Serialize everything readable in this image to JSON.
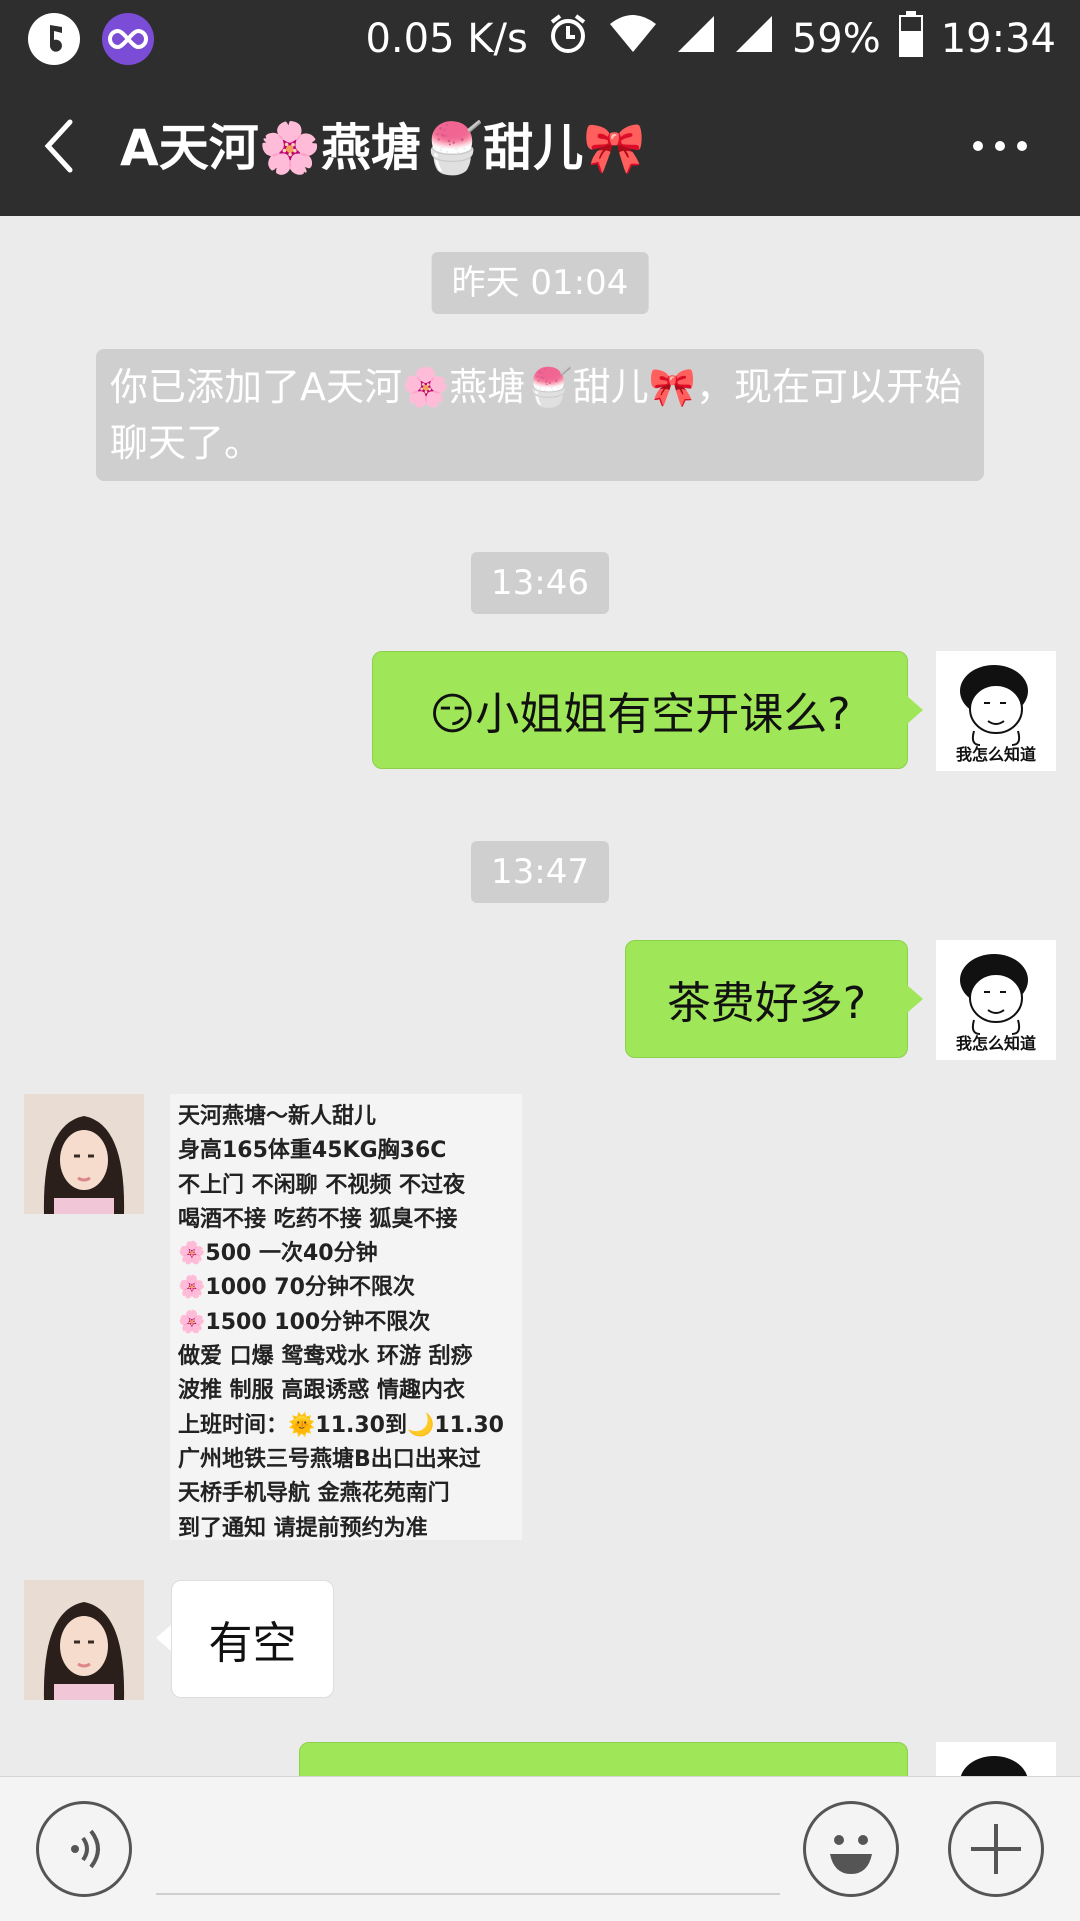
{
  "status_bar": {
    "network_speed": "0.05 K/s",
    "battery": "59%",
    "time": "19:34"
  },
  "header": {
    "title": "A天河🌸燕塘🍧甜儿🎀"
  },
  "messages": {
    "timestamp_1": "昨天 01:04",
    "system_notice": "你已添加了A天河🌸燕塘🍧甜儿🎀，现在可以开始聊天了。",
    "timestamp_2": "13:46",
    "msg_1": "😏小姐姐有空开课么?",
    "timestamp_3": "13:47",
    "msg_2": "茶费好多?",
    "sticker_caption": "我怎么知道",
    "card_lines": [
      "天河燕塘～新人甜儿",
      "身高165体重45KG胸36C",
      "不上门 不闲聊 不视频 不过夜",
      "喝酒不接 吃药不接 狐臭不接",
      "🌸500 一次40分钟",
      "🌸1000 70分钟不限次",
      "🌸1500 100分钟不限次",
      "做爱 口爆 鸳鸯戏水 环游 刮痧",
      "波推 制服 高跟诱惑 情趣内衣",
      "上班时间：🌞11.30到🌙11.30",
      "广州地铁三号燕塘B出口出来过",
      "天桥手机导航 金燕花苑南门",
      "到了通知 请提前预约为准"
    ],
    "msg_3": "有空"
  },
  "colors": {
    "bar_bg": "#2e2e2e",
    "chat_bg": "#ebebeb",
    "bubble_sent": "#9fe658",
    "bubble_received": "#ffffff",
    "timestamp_bg": "#cfcfcf"
  },
  "icons": {
    "status_left": [
      "music-app-icon",
      "infinity-app-icon"
    ],
    "status_right": [
      "alarm-icon",
      "wifi-icon",
      "signal-icon",
      "signal-icon",
      "battery-icon"
    ],
    "header_left": "back-arrow-icon",
    "header_right": "more-icon",
    "input_left": "voice-icon",
    "input_right": [
      "emoji-icon",
      "plus-icon"
    ]
  }
}
